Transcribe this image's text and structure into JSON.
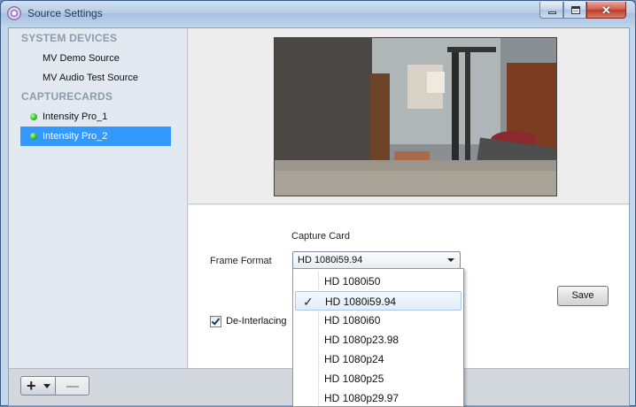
{
  "window": {
    "title": "Source Settings"
  },
  "sidebar": {
    "sections": [
      {
        "heading": "SYSTEM DEVICES",
        "items": [
          {
            "label": "MV Demo Source"
          },
          {
            "label": "MV Audio Test Source"
          }
        ]
      },
      {
        "heading": "CAPTURECARDS",
        "items": [
          {
            "label": "Intensity Pro_1",
            "status_icon": "green-led-icon"
          },
          {
            "label": "Intensity Pro_2",
            "status_icon": "green-led-icon",
            "selected": true
          }
        ]
      }
    ]
  },
  "bottom_bar": {
    "add_icon": "plus-icon",
    "menu_icon": "chevron-down-icon",
    "remove_icon": "minus-icon"
  },
  "settings": {
    "capture_card_label": "Capture Card",
    "frame_format_label": "Frame Format",
    "frame_format_value": "HD 1080i59.94",
    "save_label": "Save",
    "deinterlacing_label": "De-Interlacing",
    "deinterlacing_checked": true
  },
  "dropdown": {
    "options": [
      {
        "label": "HD 1080i50"
      },
      {
        "label": "HD 1080i59.94",
        "selected": true
      },
      {
        "label": "HD 1080i60"
      },
      {
        "label": "HD 1080p23.98"
      },
      {
        "label": "HD 1080p24"
      },
      {
        "label": "HD 1080p25"
      },
      {
        "label": "HD 1080p29.97"
      }
    ]
  },
  "colors": {
    "selection": "#3399ff",
    "status_led": "#2fb81d",
    "sidebar_bg": "#e3e9f1",
    "section_heading": "#8c9aab"
  }
}
